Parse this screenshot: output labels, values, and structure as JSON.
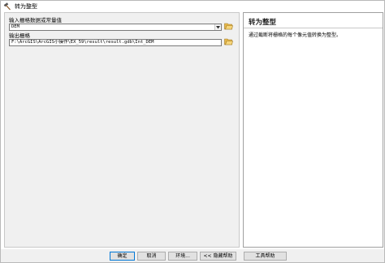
{
  "window": {
    "title": "转为整型"
  },
  "params": [
    {
      "label": "输入栅格数据或常量值",
      "value": "DEM",
      "has_dropdown": true
    },
    {
      "label": "输出栅格",
      "value": "F:\\ArcGIS\\ArcGIS小操作\\EX_59\\result\\result.gdb\\Int_DEM",
      "has_dropdown": false
    }
  ],
  "help": {
    "title": "转为整型",
    "description": "通过截断将栅格的每个像元值转换为整型。"
  },
  "buttons": {
    "ok": "确定",
    "cancel": "取消",
    "environments": "环境...",
    "hide_help": "<< 隐藏帮助",
    "tool_help": "工具帮助"
  },
  "icons": {
    "title_icon": "hammer-icon",
    "browse_icon": "open-folder-icon",
    "dropdown_icon": "chevron-down-icon"
  },
  "colors": {
    "folder": "#e8b94a",
    "button_focus": "#0078d7"
  }
}
